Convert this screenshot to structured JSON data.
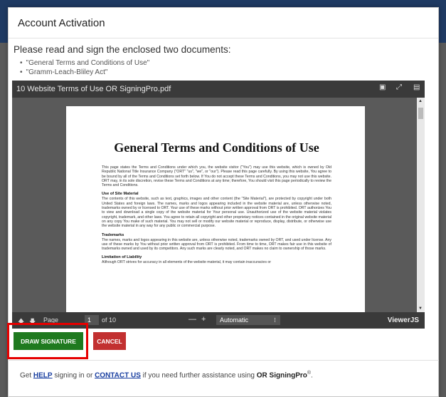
{
  "modal": {
    "title": "Account Activation",
    "intro": "Please read and sign the enclosed two documents:",
    "documents": [
      "\"General Terms and Conditions of Use\"",
      "\"Gramm-Leach-Bliley Act\""
    ]
  },
  "viewer": {
    "filename": "10 Website Terms of Use OR SigningPro.pdf",
    "tools": [
      "print-icon",
      "fullscreen-icon",
      "download-icon"
    ],
    "page_label": "Page",
    "page_current": "1",
    "page_total": "of 10",
    "zoom_minus": "—",
    "zoom_plus": "+",
    "zoom_value": "Automatic",
    "brand": "ViewerJS",
    "document": {
      "title": "General Terms and Conditions of Use",
      "intro": "This page states the Terms and Conditions under which you, the website visitor (\"You\") may use this website, which is owned by Old Republic National Title Insurance Company (\"ORT\" \"us\", \"we\", or \"our\"). Please read this page carefully. By using this website, You agree to be bound by all of the Terms and Conditions set forth below. If You do not accept these Terms and Conditions, you may not use this website. ORT may, in its sole discretion, revise these Terms and Conditions at any time; therefore, You should visit this page periodically to review the Terms and Conditions.",
      "sections": [
        {
          "heading": "Use of Site Material",
          "body": "The contents of this website, such as text, graphics, images and other content (the \"Site Material\"), are protected by copyright under both United States and foreign laws. The names, marks and logos appearing included in the website material are, unless otherwise noted, trademarks owned by or licensed to ORT. Your use of these marks without prior written approval from ORT is prohibited. ORT authorizes You to view and download a single copy of the website material for Your personal use. Unauthorized use of the website material violates copyright, trademark, and other laws. You agree to retain all copyright and other proprietary notices contained in the original website material on any copy You make of such material. You may not sell or modify our website material or reproduce, display, distribute, or otherwise use the website material in any way for any public or commercial purpose."
        },
        {
          "heading": "Trademarks",
          "body": "The names, marks and logos appearing in this website are, unless otherwise noted, trademarks owned by ORT, and used under license. Any use of these marks by You without prior written approval from ORT is prohibited. From time to time, ORT makes fair use in this website of trademarks owned and used by its competitors. Any such marks are clearly noted, and ORT makes no claim to ownership of those marks."
        },
        {
          "heading": "Limitation of Liability",
          "body": "Although ORT strives for accuracy in all elements of the website material, it may contain inaccuracies or"
        }
      ]
    }
  },
  "actions": {
    "draw_signature": "DRAW SIGNATURE",
    "cancel": "CANCEL"
  },
  "footer": {
    "get": "Get",
    "help": "HELP",
    "mid": "signing in or",
    "contact": "CONTACT US",
    "tail": "if you need further assistance using",
    "brand": "OR SigningPro",
    "reg": "®",
    "end": "."
  },
  "colors": {
    "draw_button": "#1f7a1f",
    "cancel_button": "#c23030",
    "highlight": "#e60000",
    "link": "#1a3fa0"
  }
}
